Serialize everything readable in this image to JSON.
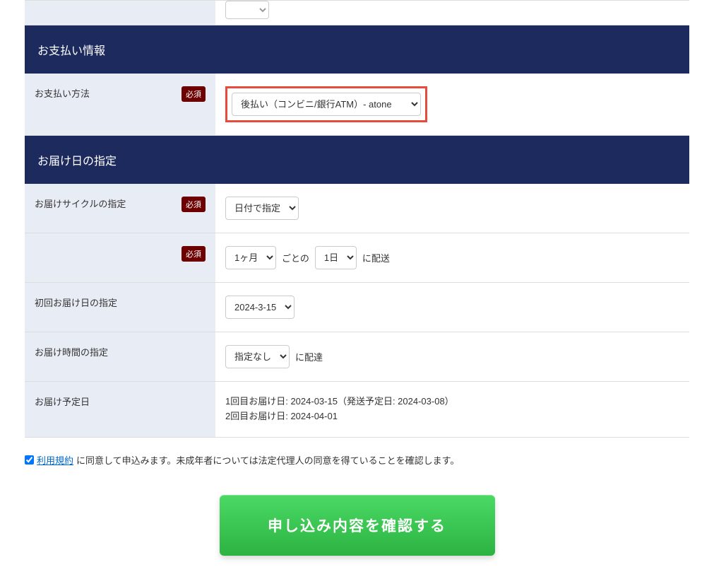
{
  "partial_top_row": {
    "select_value": ""
  },
  "payment_section": {
    "header": "お支払い情報",
    "method_row": {
      "label": "お支払い方法",
      "required": "必須",
      "select_value": "後払い（コンビニ/銀行ATM）- atone"
    }
  },
  "delivery_section": {
    "header": "お届け日の指定",
    "cycle_row": {
      "label": "お届けサイクルの指定",
      "required": "必須",
      "select_value": "日付で指定"
    },
    "interval_row": {
      "required": "必須",
      "select1_value": "1ヶ月",
      "text1": "ごとの",
      "select2_value": "1日",
      "text2": "に配送"
    },
    "first_date_row": {
      "label": "初回お届け日の指定",
      "select_value": "2024-3-15"
    },
    "time_row": {
      "label": "お届け時間の指定",
      "select_value": "指定なし",
      "text_after": "に配達"
    },
    "schedule_row": {
      "label": "お届け予定日",
      "line1": "1回目お届け日: 2024-03-15（発送予定日: 2024-03-08）",
      "line2": "2回目お届け日: 2024-04-01"
    }
  },
  "agreement": {
    "link": "利用規約",
    "text": "に同意して申込みます。未成年者については法定代理人の同意を得ていることを確認します。"
  },
  "submit_label": "申し込み内容を確認する"
}
